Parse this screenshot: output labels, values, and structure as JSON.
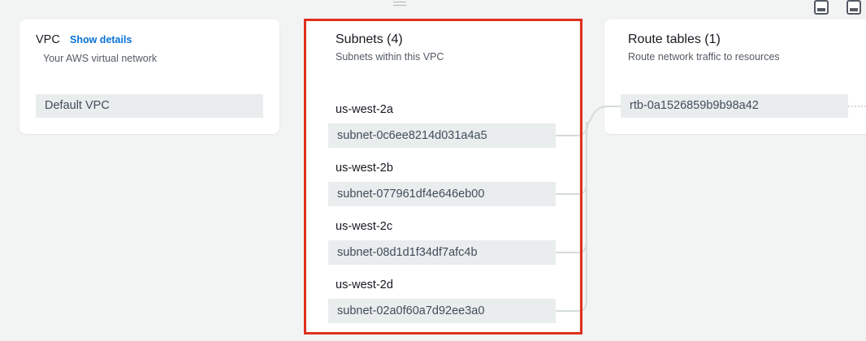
{
  "vpc": {
    "title": "VPC",
    "show_details": "Show details",
    "subtitle": "Your AWS virtual network",
    "item": "Default VPC"
  },
  "subnets": {
    "title": "Subnets (4)",
    "subtitle": "Subnets within this VPC",
    "groups": [
      {
        "az": "us-west-2a",
        "subnet": "subnet-0c6ee8214d031a4a5"
      },
      {
        "az": "us-west-2b",
        "subnet": "subnet-077961df4e646eb00"
      },
      {
        "az": "us-west-2c",
        "subnet": "subnet-08d1d1f34df7afc4b"
      },
      {
        "az": "us-west-2d",
        "subnet": "subnet-02a0f60a7d92ee3a0"
      }
    ]
  },
  "route_tables": {
    "title": "Route tables (1)",
    "subtitle": "Route network traffic to resources",
    "item": "rtb-0a1526859b9b98a42"
  },
  "colors": {
    "highlight_border": "#e0301e",
    "link": "#0972d3",
    "pill_bg": "#eaeded",
    "page_bg": "#f2f3f3"
  }
}
